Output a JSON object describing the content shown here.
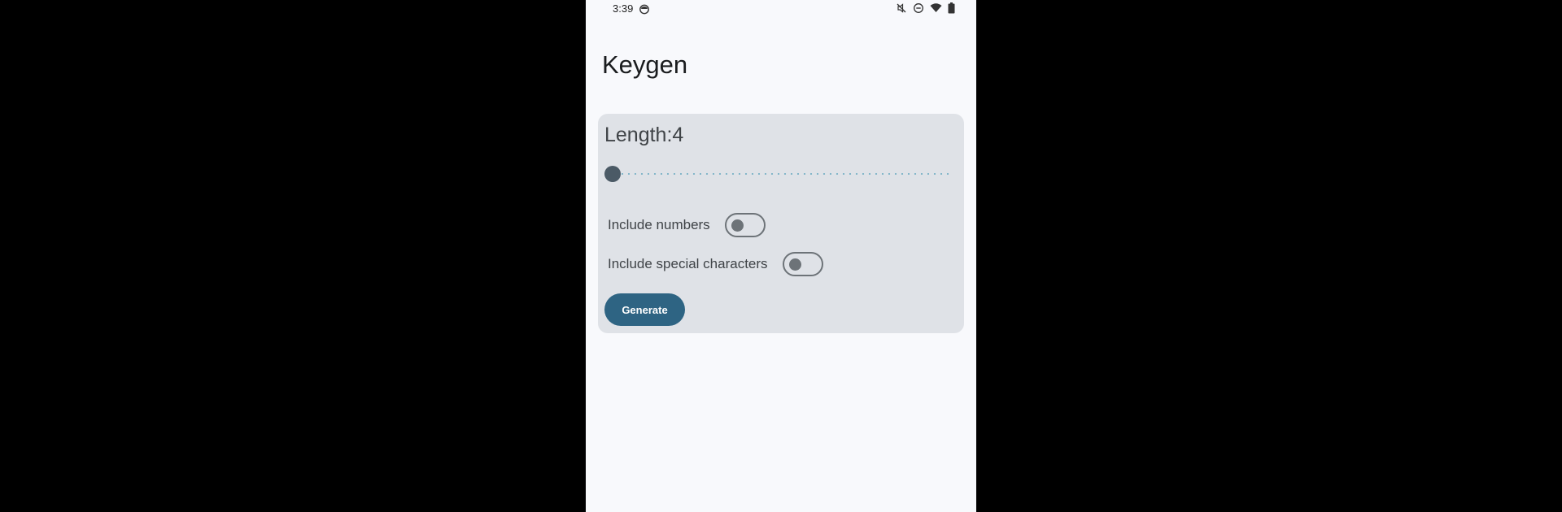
{
  "status_bar": {
    "time": "3:39",
    "icons": [
      "cat-face-icon",
      "mute-icon",
      "do-not-disturb-icon",
      "wifi-icon",
      "battery-icon"
    ]
  },
  "app": {
    "title": "Keygen"
  },
  "card": {
    "length_label": "Length:4",
    "slider": {
      "value": 4,
      "fraction": 0.0
    },
    "toggles": {
      "numbers": {
        "label": "Include numbers",
        "checked": false
      },
      "special": {
        "label": "Include special characters",
        "checked": false
      }
    },
    "generate_label": "Generate"
  },
  "colors": {
    "background": "#f8f9fc",
    "card": "#dfe2e7",
    "primary": "#2e6483",
    "slider_track": "#7fb3c8",
    "slider_thumb": "#4b5a66",
    "switch_outline": "#6d7378"
  }
}
